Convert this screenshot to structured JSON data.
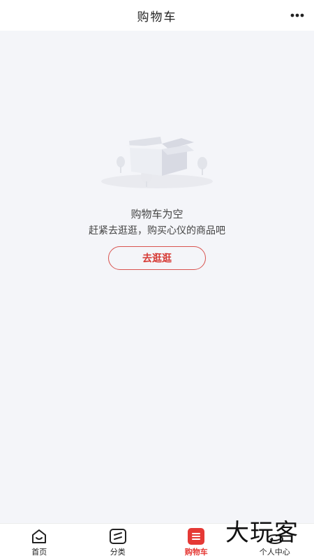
{
  "header": {
    "title": "购物车",
    "more_icon": "more-dots-icon"
  },
  "empty_state": {
    "title": "购物车为空",
    "subtitle": "赶紧去逛逛，购买心仪的商品吧",
    "button_label": "去逛逛",
    "illustration_icon": "empty-box-icon"
  },
  "tabbar": {
    "active_color": "#e53935",
    "items": [
      {
        "label": "首页",
        "icon": "home-icon"
      },
      {
        "label": "分类",
        "icon": "category-icon"
      },
      {
        "label": "购物车",
        "icon": "cart-icon",
        "active": true
      },
      {
        "label": "个人中心",
        "icon": "profile-icon"
      }
    ]
  },
  "watermark": {
    "text": "大玩客"
  }
}
